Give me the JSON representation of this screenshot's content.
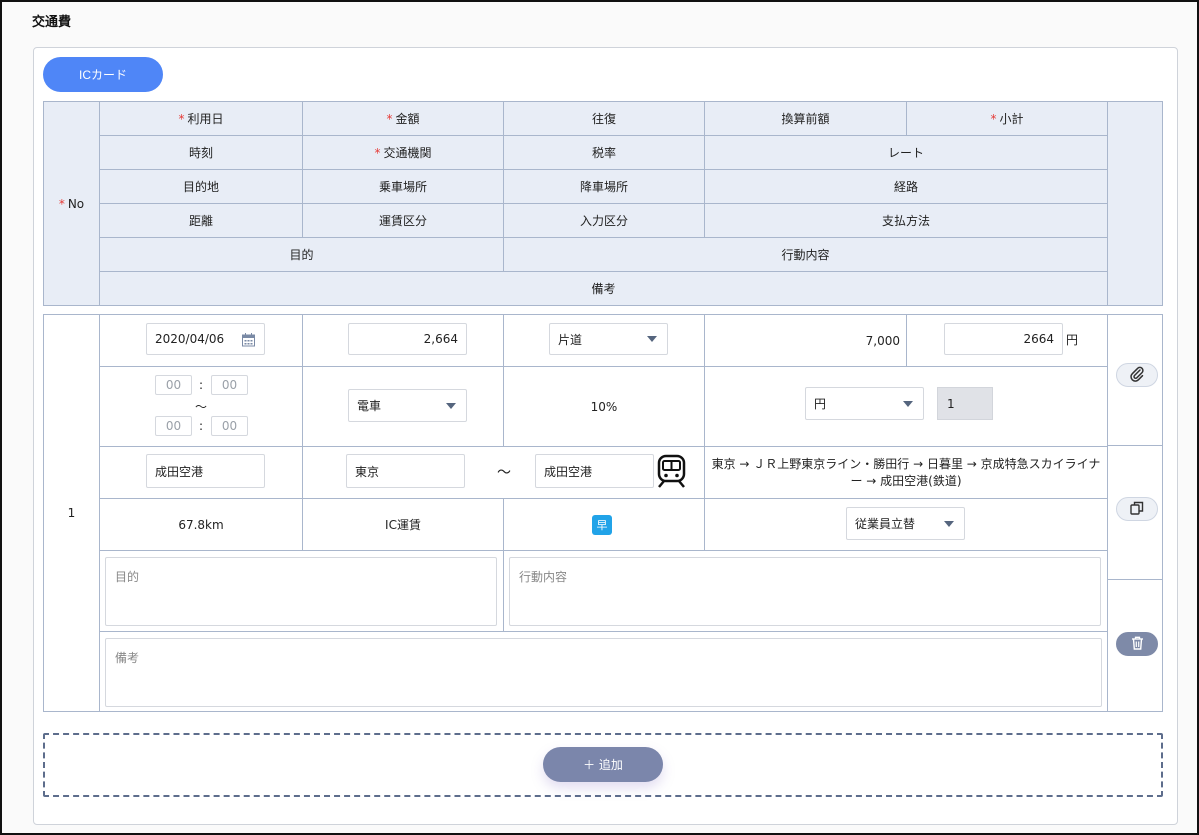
{
  "section": {
    "title": "交通費"
  },
  "ic_button": "ICカード",
  "header": {
    "no": "No",
    "row1": [
      "利用日",
      "金額",
      "往復",
      "換算前額",
      "小計"
    ],
    "row2": [
      "時刻",
      "交通機関",
      "税率",
      "レート"
    ],
    "row3": [
      "目的地",
      "乗車場所",
      "降車場所",
      "経路"
    ],
    "row4": [
      "距離",
      "運賃区分",
      "入力区分",
      "支払方法"
    ],
    "row5": [
      "目的",
      "行動内容"
    ],
    "row6": [
      "備考"
    ]
  },
  "entry": {
    "no": "1",
    "date": "2020/04/06",
    "amount": "2,664",
    "round_trip": "片道",
    "pre_conversion": "7,000",
    "subtotal": "2664",
    "subtotal_unit": "円",
    "time_from_h": "00",
    "time_from_m": "00",
    "time_to_h": "00",
    "time_to_m": "00",
    "time_sep": ":",
    "tilde": "～",
    "transport": "電車",
    "tax_rate": "10%",
    "currency": "円",
    "rate_value": "1",
    "destination": "成田空港",
    "boarding": "東京",
    "alighting": "成田空港",
    "route": "東京 → ＪＲ上野東京ライン・勝田行 → 日暮里 → 京成特急スカイライナー → 成田空港(鉄道)",
    "distance": "67.8km",
    "fare_type": "IC運賃",
    "input_type_badge": "早",
    "payment": "従業員立替",
    "purpose_placeholder": "目的",
    "action_placeholder": "行動内容",
    "remarks_placeholder": "備考"
  },
  "add_button": "＋ 追加",
  "colors": {
    "primary": "#4f86f7",
    "header_bg": "#e8edf6",
    "border": "#a9b6cc",
    "add_button": "#7b86ab",
    "badge": "#21a3e8",
    "required": "#e53935"
  }
}
